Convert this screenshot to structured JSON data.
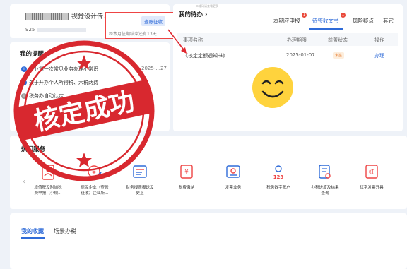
{
  "user_card": {
    "company_name_suffix": "视觉设计传...",
    "taxid_prefix": "925",
    "levy_tag": "查账征收",
    "levy_note": "距本月征期结束还有13天"
  },
  "reminders": {
    "title": "我的提醒",
    "title_arrow": "›",
    "items": [
      {
        "text": "开业第一次常见业务办理小常识",
        "date": "2025-...27",
        "dot": "i"
      },
      {
        "text": "关于开办个人所得税、六税两费",
        "date": "",
        "dot": "i"
      },
      {
        "text": "税务办自动认定...",
        "date": "",
        "dot": "i"
      }
    ]
  },
  "todo": {
    "top_strip": "二维码请查看更多",
    "title": "我的待办",
    "title_arrow": "›",
    "tabs": [
      {
        "label": "本期应申报",
        "badge": "1"
      },
      {
        "label": "待签收文书",
        "badge": "1"
      },
      {
        "label": "风险疑点",
        "badge": ""
      },
      {
        "label": "其它",
        "badge": ""
      }
    ],
    "columns": [
      "事项名称",
      "办理期限",
      "前置状态",
      "操作"
    ],
    "row": {
      "name": "《核定定额通知书》",
      "deadline": "2025-01-07",
      "status": "未签",
      "action": "办理"
    }
  },
  "services": {
    "title": "热门服务",
    "prev_arrow": "‹",
    "items": [
      {
        "line1": "增值税及附加税",
        "line2": "费申报（小规...",
        "icon": "person-doc-icon"
      },
      {
        "line1": "居民企业（查账",
        "line2": "征收）企业所...",
        "icon": "yen-edit-icon"
      },
      {
        "line1": "财务报表报送及",
        "line2": "更正",
        "icon": "report-icon"
      },
      {
        "line1": "税费缴纳",
        "line2": "",
        "icon": "tax-pay-icon"
      },
      {
        "line1": "发票业务",
        "line2": "",
        "icon": "invoice-icon"
      },
      {
        "line1": "税务数字账户",
        "line2": "",
        "icon": "digital-account-icon"
      },
      {
        "line1": "办税进度及结果",
        "line2": "查询",
        "icon": "progress-query-icon"
      },
      {
        "line1": "红字发票开具",
        "line2": "",
        "icon": "red-invoice-icon"
      }
    ]
  },
  "bottom": {
    "tabs": [
      {
        "label": "我的收藏",
        "active": true
      },
      {
        "label": "场景办税",
        "active": false
      }
    ]
  },
  "stamp": {
    "text": "核定成功"
  },
  "colors": {
    "accent": "#2f6bd8",
    "stamp_red": "#d8282f",
    "badge_red": "#e94b3c",
    "smiley_yellow": "#ffd33d"
  }
}
